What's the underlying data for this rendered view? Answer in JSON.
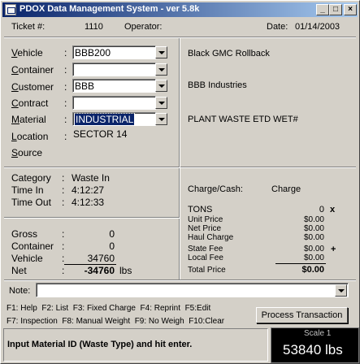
{
  "window": {
    "title": "PDOX Data Management System - ver 5.8k",
    "minimize": "_",
    "maximize": "□",
    "close": "×"
  },
  "header": {
    "ticket_label": "Ticket #:",
    "ticket_value": "1110",
    "operator_label": "Operator:",
    "operator_value": "",
    "date_label": "Date:",
    "date_value": "01/14/2003"
  },
  "form": {
    "vehicle": {
      "label_u": "V",
      "label_rest": "ehicle",
      "colon": ":",
      "value": "BBB200",
      "description": "Black GMC Rollback"
    },
    "container": {
      "label_u": "C",
      "label_rest": "ontainer",
      "colon": ":",
      "value": ""
    },
    "customer": {
      "label_u": "C",
      "label_rest": "ustomer",
      "colon": ":",
      "value": "BBB",
      "description": "BBB Industries"
    },
    "contract": {
      "label_u": "C",
      "label_rest": "ontract",
      "colon": ":",
      "value": ""
    },
    "material": {
      "label_u": "M",
      "label_rest": "aterial",
      "colon": ":",
      "value": "INDUSTRIAL",
      "description": "PLANT WASTE ETD WET#"
    },
    "location": {
      "label_u": "L",
      "label_rest": "ocation",
      "colon": ":",
      "value": "SECTOR 14"
    },
    "source": {
      "label_u": "S",
      "label_rest": "ource",
      "colon": ""
    }
  },
  "category": {
    "category_label": "Category",
    "category_value": "Waste In",
    "time_in_label": "Time In",
    "time_in_value": "4:12:27",
    "time_out_label": "Time Out",
    "time_out_value": "4:12:33",
    "colon": ":"
  },
  "weights": {
    "gross_label": "Gross",
    "gross_value": "0",
    "container_label": "Container",
    "container_value": "0",
    "vehicle_label": "Vehicle",
    "vehicle_value": "34760",
    "net_label": "Net",
    "net_value": "-34760",
    "unit": "lbs",
    "colon": ":"
  },
  "charges": {
    "charge_cash_label": "Charge/Cash:",
    "charge_cash_value": "Charge",
    "tons_label": "TONS",
    "tons_value": "0",
    "tons_mark": "x",
    "unit_price_label": "Unit Price",
    "unit_price_value": "$0.00",
    "net_price_label": "Net Price",
    "net_price_value": "$0.00",
    "haul_charge_label": "Haul Charge",
    "haul_charge_value": "$0.00",
    "state_fee_label": "State Fee",
    "state_fee_value": "$0.00",
    "state_fee_mark": "+",
    "local_fee_label": "Local Fee",
    "local_fee_value": "$0.00",
    "total_price_label": "Total Price",
    "total_price_value": "$0.00"
  },
  "note": {
    "label": "Note:",
    "value": ""
  },
  "hotkeys": {
    "line1": [
      "F1: Help",
      "F2: List",
      "F3: Fixed Charge",
      "F4: Reprint",
      "F5:Edit"
    ],
    "line2": [
      "F7: Inspection",
      "F8: Manual Weight",
      "F9: No Weigh",
      "F10:Clear"
    ]
  },
  "process_button": "Process Transaction",
  "status": {
    "message": "Input Material ID (Waste Type) and hit enter.",
    "scale_label": "Scale 1",
    "scale_value": "53840 lbs"
  }
}
